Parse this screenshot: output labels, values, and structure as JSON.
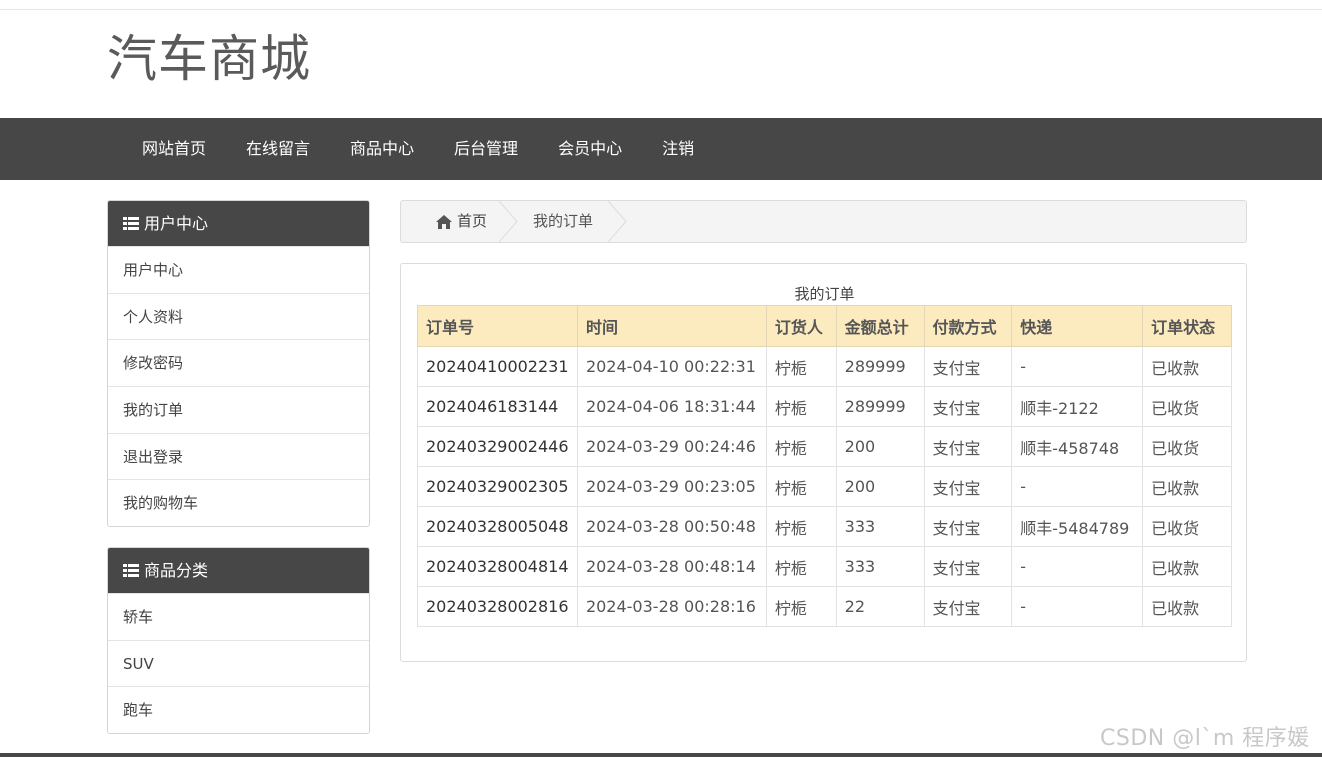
{
  "site": {
    "title": "汽车商城"
  },
  "nav": [
    {
      "label": "网站首页"
    },
    {
      "label": "在线留言"
    },
    {
      "label": "商品中心"
    },
    {
      "label": "后台管理"
    },
    {
      "label": "会员中心"
    },
    {
      "label": "注销"
    }
  ],
  "user_panel": {
    "title": "用户中心",
    "items": [
      "用户中心",
      "个人资料",
      "修改密码",
      "我的订单",
      "退出登录",
      "我的购物车"
    ]
  },
  "category_panel": {
    "title": "商品分类",
    "items": [
      "轿车",
      "SUV",
      "跑车"
    ]
  },
  "breadcrumb": {
    "home": "首页",
    "current": "我的订单"
  },
  "orders": {
    "caption": "我的订单",
    "headers": [
      "订单号",
      "时间",
      "订货人",
      "金额总计",
      "付款方式",
      "快递",
      "订单状态"
    ],
    "rows": [
      [
        "20240410002231",
        "2024-04-10 00:22:31",
        "柠栀",
        "289999",
        "支付宝",
        "-",
        "已收款"
      ],
      [
        "2024046183144",
        "2024-04-06 18:31:44",
        "柠栀",
        "289999",
        "支付宝",
        "顺丰-2122",
        "已收货"
      ],
      [
        "20240329002446",
        "2024-03-29 00:24:46",
        "柠栀",
        "200",
        "支付宝",
        "顺丰-458748",
        "已收货"
      ],
      [
        "20240329002305",
        "2024-03-29 00:23:05",
        "柠栀",
        "200",
        "支付宝",
        "-",
        "已收款"
      ],
      [
        "20240328005048",
        "2024-03-28 00:50:48",
        "柠栀",
        "333",
        "支付宝",
        "顺丰-5484789",
        "已收货"
      ],
      [
        "20240328004814",
        "2024-03-28 00:48:14",
        "柠栀",
        "333",
        "支付宝",
        "-",
        "已收款"
      ],
      [
        "20240328002816",
        "2024-03-28 00:28:16",
        "柠栀",
        "22",
        "支付宝",
        "-",
        "已收款"
      ]
    ]
  },
  "watermark": "CSDN @l`m 程序媛",
  "colors": {
    "nav_bg": "#474747",
    "table_header_bg": "#fdebc0"
  }
}
